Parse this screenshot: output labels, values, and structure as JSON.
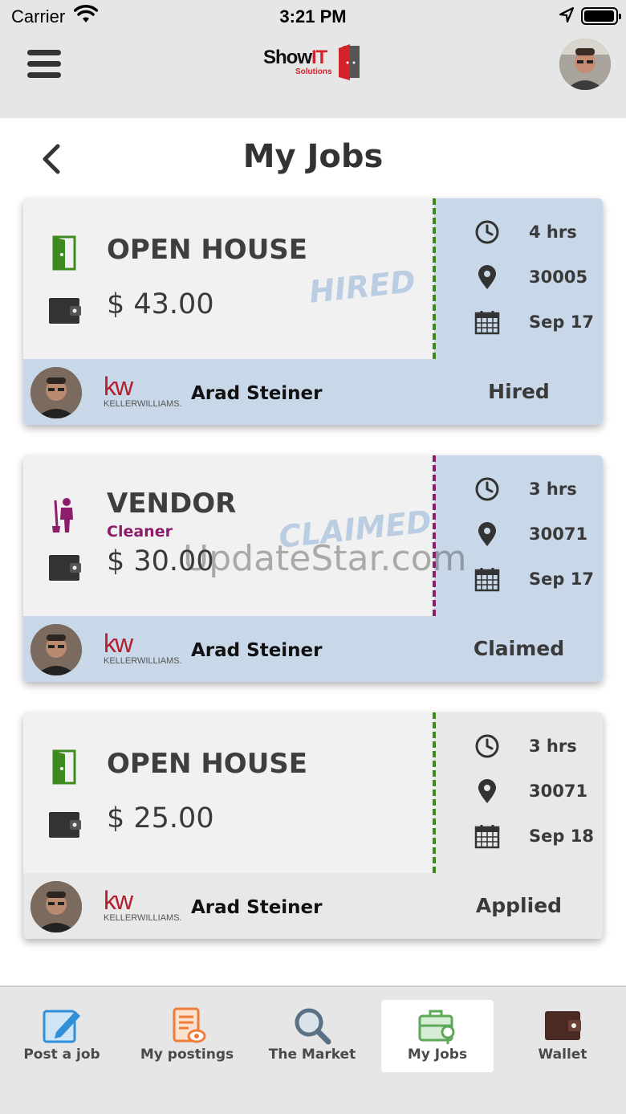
{
  "status_bar": {
    "carrier": "Carrier",
    "time": "3:21 PM"
  },
  "header": {
    "logo_text_show": "Show",
    "logo_text_it": "IT",
    "logo_text_solutions": "Solutions",
    "menu_icon": "hamburger-icon",
    "profile_icon": "avatar"
  },
  "page": {
    "title": "My Jobs",
    "back_icon": "chevron-left-icon"
  },
  "jobs": [
    {
      "type": "OPEN HOUSE",
      "subtype": "",
      "price": "$ 43.00",
      "stamp": "HIRED",
      "duration": "4 hrs",
      "zip": "30005",
      "date": "Sep 17",
      "agent": "Arad Steiner",
      "brand": "kw",
      "brand_name": "KELLERWILLIAMS.",
      "status": "Hired",
      "theme": "blue",
      "icon": "door-icon",
      "icon_color": "#3d8b1f",
      "divider_color": "#3d8b1f"
    },
    {
      "type": "VENDOR",
      "subtype": "Cleaner",
      "price": "$ 30.00",
      "stamp": "CLAIMED",
      "duration": "3 hrs",
      "zip": "30071",
      "date": "Sep 17",
      "agent": "Arad Steiner",
      "brand": "kw",
      "brand_name": "KELLERWILLIAMS.",
      "status": "Claimed",
      "theme": "blue",
      "icon": "cleaner-icon",
      "icon_color": "#8b1d6b",
      "divider_color": "#8b1d6b"
    },
    {
      "type": "OPEN HOUSE",
      "subtype": "",
      "price": "$ 25.00",
      "stamp": "",
      "duration": "3 hrs",
      "zip": "30071",
      "date": "Sep 18",
      "agent": "Arad Steiner",
      "brand": "kw",
      "brand_name": "KELLERWILLIAMS.",
      "status": "Applied",
      "theme": "grey",
      "icon": "door-icon",
      "icon_color": "#3d8b1f",
      "divider_color": "#3d8b1f"
    }
  ],
  "watermark": "UpdateStar.com",
  "tabbar": {
    "tabs": [
      {
        "label": "Post a job",
        "icon": "edit-icon",
        "active": false
      },
      {
        "label": "My postings",
        "icon": "document-eye-icon",
        "active": false
      },
      {
        "label": "The Market",
        "icon": "search-icon",
        "active": false
      },
      {
        "label": "My Jobs",
        "icon": "briefcase-icon",
        "active": true
      },
      {
        "label": "Wallet",
        "icon": "wallet-icon",
        "active": false
      }
    ]
  },
  "colors": {
    "card_blue": "#c8d8e9",
    "card_grey": "#e8e8e8",
    "open_house_green": "#3d8b1f",
    "vendor_purple": "#8b1d6b",
    "brand_red": "#d3222a"
  }
}
